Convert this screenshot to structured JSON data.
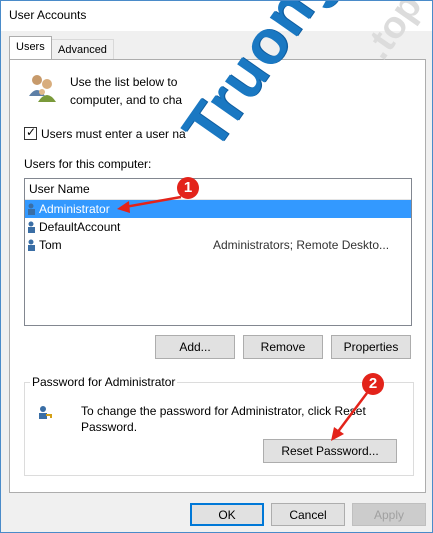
{
  "window": {
    "title": "User Accounts"
  },
  "tabs": [
    {
      "label": "Users",
      "active": true
    },
    {
      "label": "Advanced",
      "active": false
    }
  ],
  "intro": {
    "line1": "Use the list below to",
    "line2": "computer, and to cha"
  },
  "checkbox": {
    "label": "Users must enter a user na",
    "checked": true
  },
  "users_section": {
    "label": "Users for this computer:",
    "column_header": "User Name",
    "rows": [
      {
        "name": "Administrator",
        "group": "",
        "selected": true
      },
      {
        "name": "DefaultAccount",
        "group": "",
        "selected": false
      },
      {
        "name": "Tom",
        "group": "Administrators; Remote Deskto...",
        "selected": false
      }
    ]
  },
  "buttons": {
    "add": "Add...",
    "remove": "Remove",
    "properties": "Properties",
    "reset_password": "Reset Password...",
    "ok": "OK",
    "cancel": "Cancel",
    "apply": "Apply"
  },
  "password_group": {
    "legend": "Password for Administrator",
    "text_line1": "To change the password for Administrator, click Reset",
    "text_line2": "Password."
  },
  "annotations": {
    "marker1": "1",
    "marker2": "2",
    "color": "#e3231a"
  },
  "watermark": {
    "text": "Truongtin",
    "tld": ".top",
    "color": "#1a78c2"
  },
  "colors": {
    "selection": "#3399ff",
    "accent": "#0078d7"
  }
}
